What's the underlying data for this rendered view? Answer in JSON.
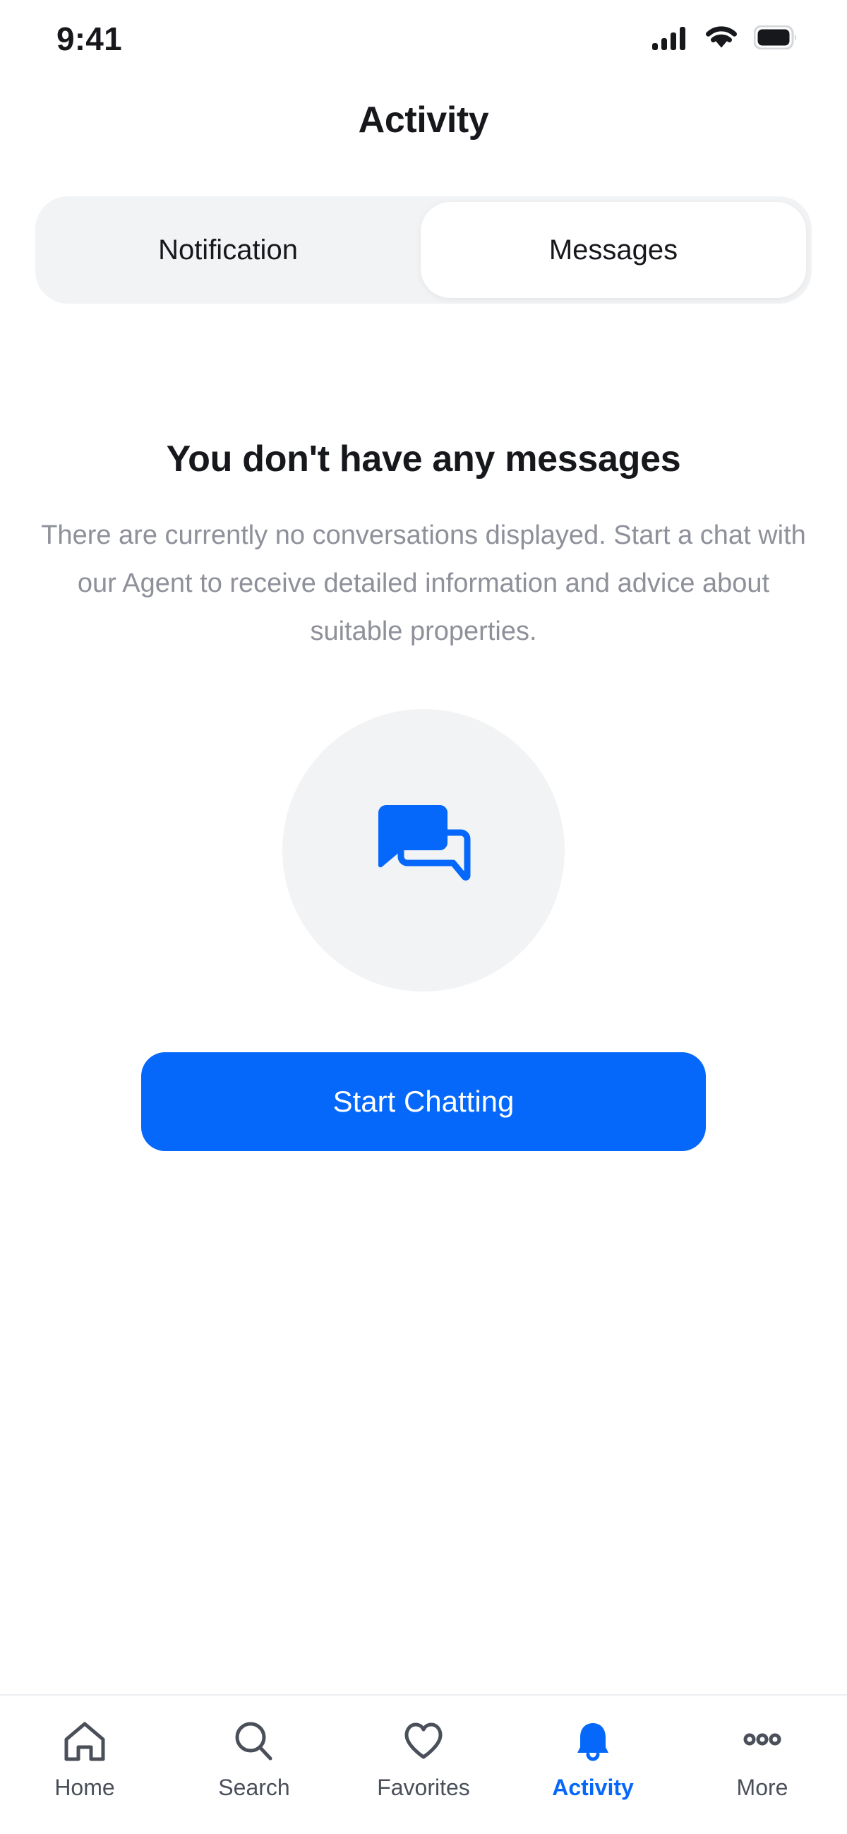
{
  "status_bar": {
    "time": "9:41",
    "signal_icon": "cellular-signal-icon",
    "wifi_icon": "wifi-icon",
    "battery_icon": "battery-full-icon"
  },
  "header": {
    "title": "Activity"
  },
  "segmented_control": {
    "tabs": [
      {
        "label": "Notification",
        "active": false
      },
      {
        "label": "Messages",
        "active": true
      }
    ]
  },
  "empty_state": {
    "title": "You don't have any messages",
    "description": "There are currently no conversations displayed. Start a chat with our Agent to receive detailed information and advice about suitable properties.",
    "illustration_icon": "chat-bubbles-icon",
    "cta_label": "Start Chatting"
  },
  "bottom_nav": {
    "items": [
      {
        "label": "Home",
        "icon": "home-icon",
        "active": false
      },
      {
        "label": "Search",
        "icon": "search-icon",
        "active": false
      },
      {
        "label": "Favorites",
        "icon": "heart-icon",
        "active": false
      },
      {
        "label": "Activity",
        "icon": "bell-icon",
        "active": true
      },
      {
        "label": "More",
        "icon": "more-dots-icon",
        "active": false
      }
    ]
  },
  "colors": {
    "accent": "#0568fa",
    "text_primary": "#17181c",
    "text_secondary": "#8e909a",
    "nav_inactive": "#4a4f5a",
    "surface_muted": "#f2f3f5"
  }
}
